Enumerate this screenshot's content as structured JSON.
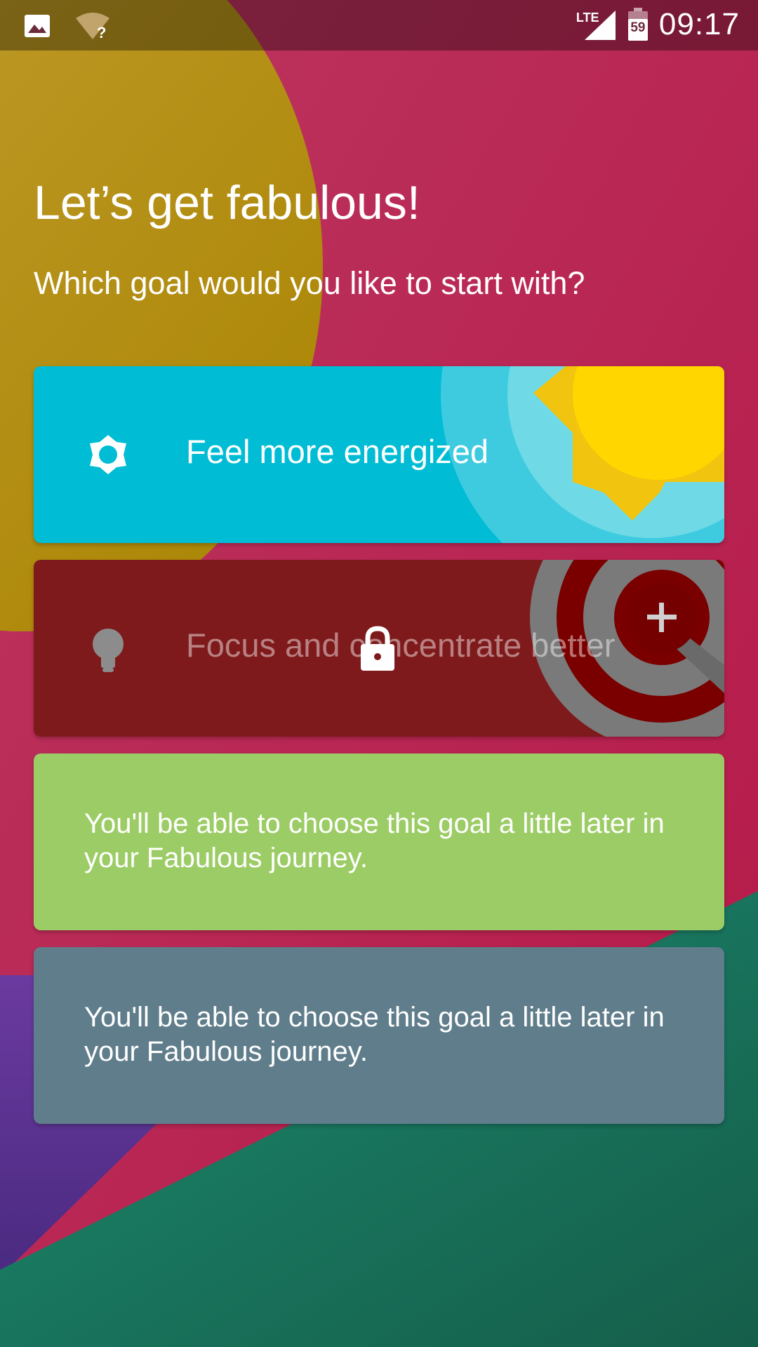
{
  "status_bar": {
    "time": "09:17",
    "network": "LTE",
    "battery_level": "59",
    "icons": [
      "image-notification-icon",
      "wifi-unknown-icon",
      "signal-icon",
      "battery-icon"
    ]
  },
  "header": {
    "title": "Let’s get fabulous!",
    "subtitle": "Which goal would you like to start with?"
  },
  "goals": [
    {
      "label": "Feel more energized",
      "icon": "sun-icon",
      "color": "#00bcd4",
      "locked": false
    },
    {
      "label": "Focus and concentrate better",
      "icon": "lightbulb-icon",
      "color": "#7f1a1c",
      "locked": true
    }
  ],
  "locked_cards": [
    {
      "message": "You'll be able to choose this goal a little later in your Fabulous journey.",
      "color": "#9ccc65"
    },
    {
      "message": "You'll be able to choose this goal a little later in your Fabulous journey.",
      "color": "#607d8b"
    }
  ],
  "colors": {
    "background_pink": "#c2305a",
    "background_gold": "#b8920f",
    "background_green": "#1a7a64",
    "background_purple": "#5a2f8a"
  }
}
